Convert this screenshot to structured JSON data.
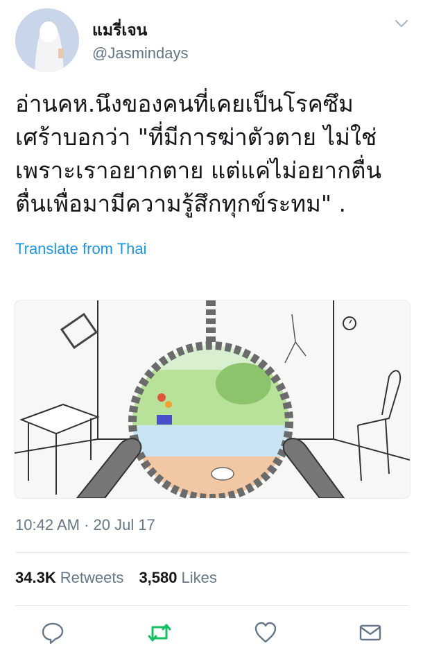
{
  "user": {
    "display_name": "แมรี่เจน",
    "handle": "@Jasmindays"
  },
  "tweet": {
    "text": "อ่านคห.นึงของคนที่เคยเป็นโรคซึม\nเศร้าบอกว่า \"ที่มีการฆ่าตัวตาย ไม่ใช่\nเพราะเราอยากตาย แต่แค่ไม่อยากตื่น\nตื่นเพื่อมามีความรู้สึกทุกข์ระทม\" .",
    "translate_label": "Translate from Thai",
    "timestamp": "10:42 AM · 20 Jul 17"
  },
  "stats": {
    "retweets_count": "34.3K",
    "retweets_label": "Retweets",
    "likes_count": "3,580",
    "likes_label": "Likes"
  },
  "actions": [
    "reply-icon",
    "retweet-icon",
    "like-icon",
    "message-icon"
  ],
  "colors": {
    "link": "#1b95e0",
    "secondary_text": "#657786",
    "retweet_active": "#17bf63",
    "divider": "#e1e8ed"
  }
}
